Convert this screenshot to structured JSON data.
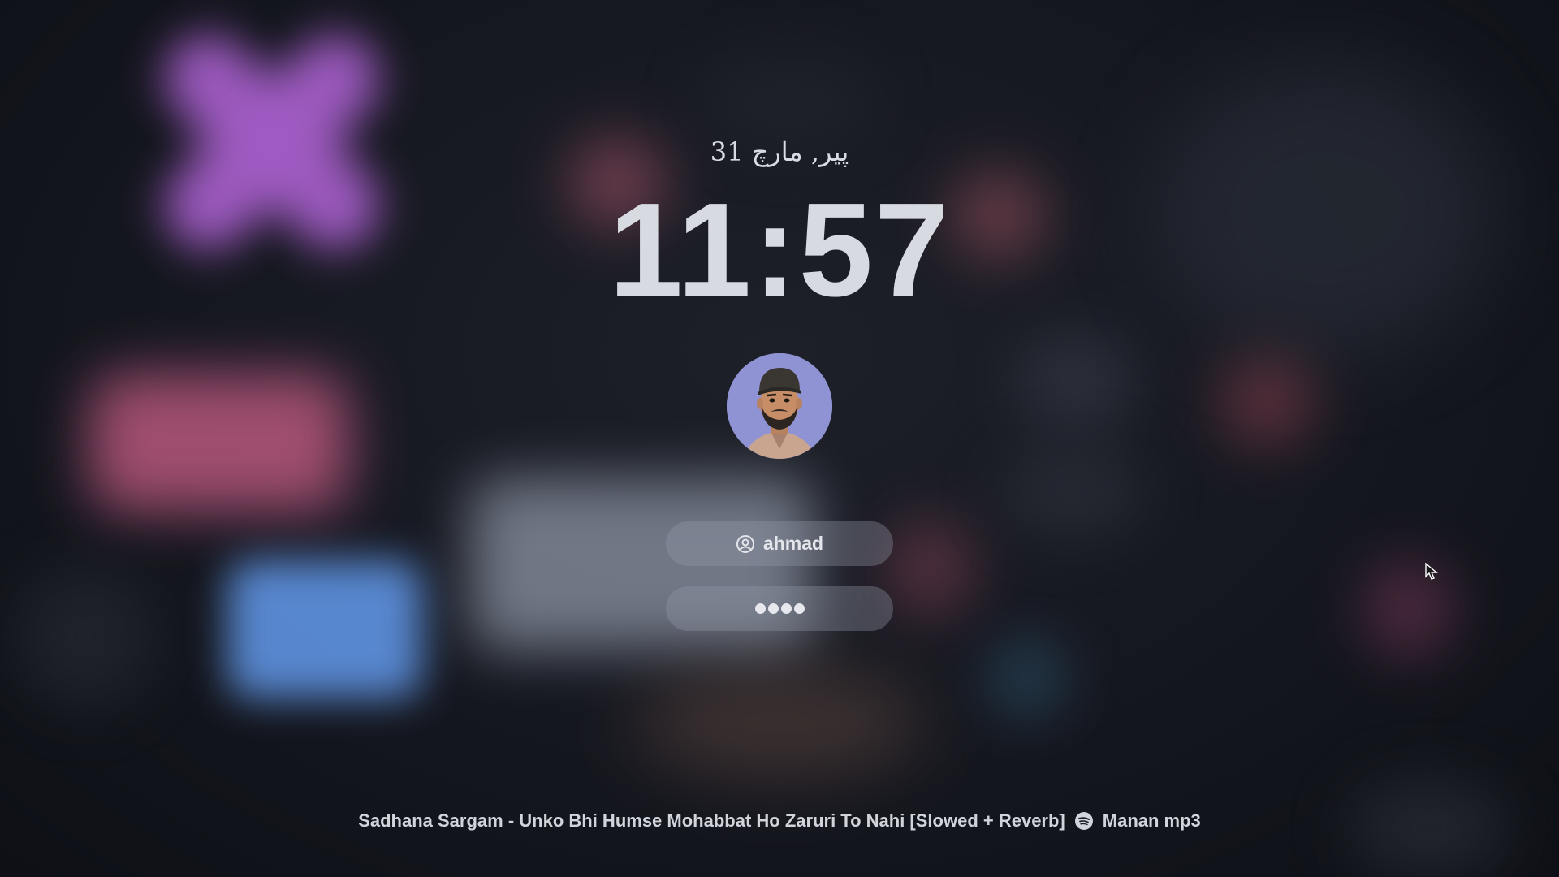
{
  "lock_screen": {
    "date": "پیر, مارچ 31",
    "time": "11:57",
    "user": {
      "avatar_icon": "user-avatar",
      "username": "ahmad",
      "username_icon": "user-circle-icon"
    },
    "password": {
      "masked_length": 4,
      "mask_char": "●"
    }
  },
  "now_playing": {
    "track": "Sadhana Sargam - Unko Bhi Humse Mohabbat Ho Zaruri To Nahi [Slowed + Reverb]",
    "source_icon": "spotify-icon",
    "artist": "Manan mp3"
  },
  "colors": {
    "accent_x": "#a15cc4",
    "field_bg": "rgba(150,155,168,0.35)",
    "text": "#d8dae1"
  }
}
